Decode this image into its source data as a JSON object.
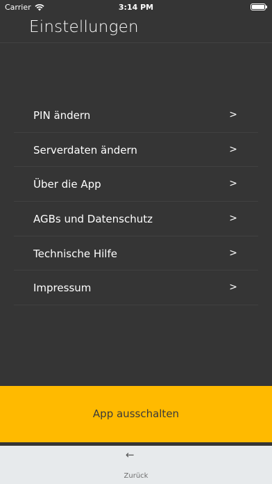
{
  "status_bar": {
    "carrier": "Carrier",
    "time": "3:14 PM",
    "wifi_icon": "wifi-icon",
    "battery_icon": "battery-icon"
  },
  "header": {
    "title": "Einstellungen"
  },
  "menu": {
    "chevron": ">",
    "items": [
      {
        "label": "PIN ändern"
      },
      {
        "label": "Serverdaten ändern"
      },
      {
        "label": "Über die App"
      },
      {
        "label": "AGBs und Datenschutz"
      },
      {
        "label": "Technische Hilfe"
      },
      {
        "label": "Impressum"
      }
    ]
  },
  "actions": {
    "power_off_label": "App ausschalten"
  },
  "footer": {
    "back_arrow": "←",
    "back_label": "Zurück"
  },
  "colors": {
    "background": "#353535",
    "accent": "#ffba00",
    "footer": "#e7eaec"
  }
}
